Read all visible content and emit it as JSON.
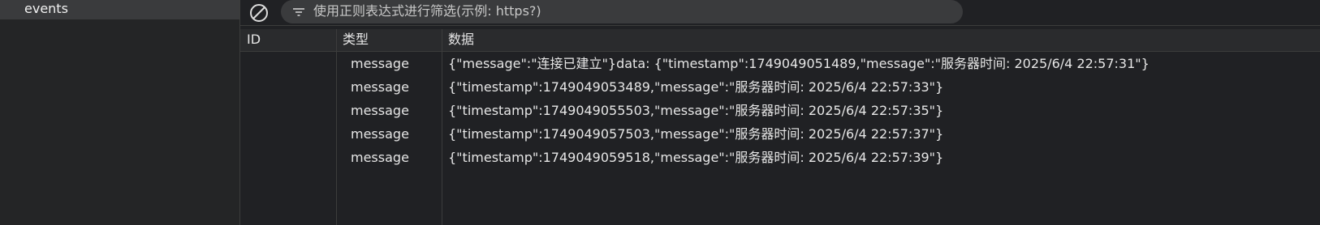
{
  "sidebar": {
    "items": [
      {
        "label": "events"
      }
    ]
  },
  "toolbar": {
    "clear_icon": "no-entry-icon",
    "filter_icon": "filter-icon",
    "filter_placeholder": "使用正则表达式进行筛选(示例: https?)"
  },
  "table": {
    "columns": [
      "ID",
      "类型",
      "数据"
    ],
    "rows": [
      {
        "id": "",
        "type": "message",
        "data": "{\"message\":\"连接已建立\"}data: {\"timestamp\":1749049051489,\"message\":\"服务器时间: 2025/6/4 22:57:31\"}"
      },
      {
        "id": "",
        "type": "message",
        "data": "{\"timestamp\":1749049053489,\"message\":\"服务器时间: 2025/6/4 22:57:33\"}"
      },
      {
        "id": "",
        "type": "message",
        "data": "{\"timestamp\":1749049055503,\"message\":\"服务器时间: 2025/6/4 22:57:35\"}"
      },
      {
        "id": "",
        "type": "message",
        "data": "{\"timestamp\":1749049057503,\"message\":\"服务器时间: 2025/6/4 22:57:37\"}"
      },
      {
        "id": "",
        "type": "message",
        "data": "{\"timestamp\":1749049059518,\"message\":\"服务器时间: 2025/6/4 22:57:39\"}"
      }
    ]
  },
  "colors": {
    "background": "#202124",
    "sidebar_selected": "#3a3b3d",
    "text": "#e6e6e6",
    "divider": "#3c3c3c"
  }
}
